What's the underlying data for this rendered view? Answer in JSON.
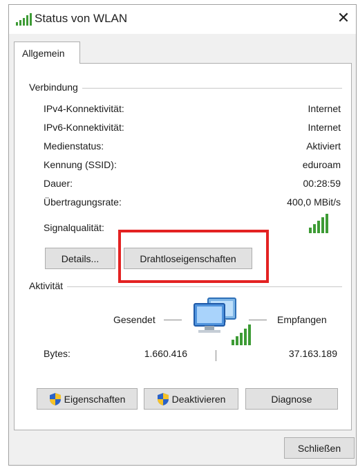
{
  "window": {
    "title": "Status von WLAN",
    "close_glyph": "✕"
  },
  "tabs": [
    {
      "label": "Allgemein"
    }
  ],
  "connection": {
    "section_label": "Verbindung",
    "rows": [
      {
        "label": "IPv4-Konnektivität:",
        "value": "Internet"
      },
      {
        "label": "IPv6-Konnektivität:",
        "value": "Internet"
      },
      {
        "label": "Medienstatus:",
        "value": "Aktiviert"
      },
      {
        "label": "Kennung (SSID):",
        "value": "eduroam"
      },
      {
        "label": "Dauer:",
        "value": "00:28:59"
      },
      {
        "label": "Übertragungsrate:",
        "value": "400,0 MBit/s"
      }
    ],
    "signal_label": "Signalqualität:",
    "signal_level": 5,
    "signal_max": 5,
    "details_button": "Details...",
    "wireless_properties_button": "Drahtloseigenschaften"
  },
  "activity": {
    "section_label": "Aktivität",
    "sent_label": "Gesendet",
    "received_label": "Empfangen",
    "bytes_label": "Bytes:",
    "bytes_sent": "1.660.416",
    "bytes_received": "37.163.189"
  },
  "bottom_buttons": {
    "properties": "Eigenschaften",
    "disable": "Deaktivieren",
    "diagnose": "Diagnose"
  },
  "close_button": "Schließen",
  "colors": {
    "signal": "#3d9b35",
    "highlight": "#e32222"
  },
  "icons": {
    "title": "wifi-signal-icon",
    "shield": "uac-shield-icon",
    "network": "network-computers-icon"
  }
}
